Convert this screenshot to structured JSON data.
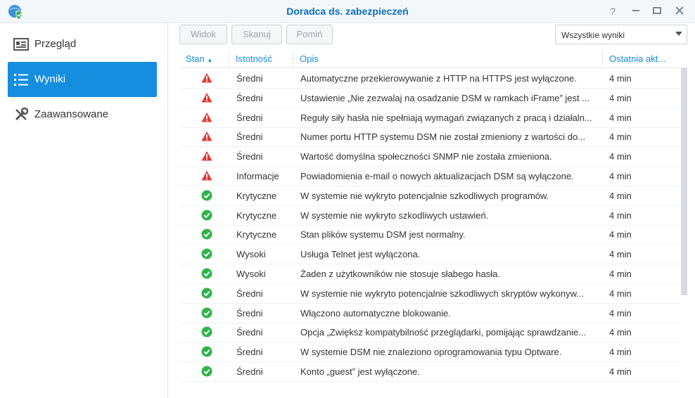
{
  "window": {
    "title": "Doradca ds. zabezpieczeń"
  },
  "sidebar": {
    "items": [
      {
        "label": "Przegląd",
        "icon": "overview-icon"
      },
      {
        "label": "Wyniki",
        "icon": "list-icon"
      },
      {
        "label": "Zaawansowane",
        "icon": "tools-icon"
      }
    ]
  },
  "toolbar": {
    "view_label": "Widok",
    "scan_label": "Skanuj",
    "skip_label": "Pomiń",
    "filter_value": "Wszystkie wyniki"
  },
  "table": {
    "columns": [
      "Stan",
      "Istotność",
      "Opis",
      "Ostatnia akt..."
    ],
    "rows": [
      {
        "status": "warning",
        "severity": "Średni",
        "description": "Automatyczne przekierowywanie z HTTP na HTTPS jest wyłączone.",
        "time": "4 min"
      },
      {
        "status": "warning",
        "severity": "Średni",
        "description": "Ustawienie „Nie zezwalaj na osadzanie DSM w ramkach iFrame” jest ...",
        "time": "4 min"
      },
      {
        "status": "warning",
        "severity": "Średni",
        "description": "Reguły siły hasła nie spełniają wymagań związanych z pracą i działaln...",
        "time": "4 min"
      },
      {
        "status": "warning",
        "severity": "Średni",
        "description": "Numer portu HTTP systemu DSM nie został zmieniony z wartości do...",
        "time": "4 min"
      },
      {
        "status": "warning",
        "severity": "Średni",
        "description": "Wartość domyślna społeczności SNMP nie została zmieniona.",
        "time": "4 min"
      },
      {
        "status": "warning",
        "severity": "Informacje",
        "description": "Powiadomienia e-mail o nowych aktualizacjach DSM są wyłączone.",
        "time": "4 min"
      },
      {
        "status": "ok",
        "severity": "Krytyczne",
        "description": "W systemie nie wykryto potencjalnie szkodliwych programów.",
        "time": "4 min"
      },
      {
        "status": "ok",
        "severity": "Krytyczne",
        "description": "W systemie nie wykryto szkodliwych ustawień.",
        "time": "4 min"
      },
      {
        "status": "ok",
        "severity": "Krytyczne",
        "description": "Stan plików systemu DSM jest normalny.",
        "time": "4 min"
      },
      {
        "status": "ok",
        "severity": "Wysoki",
        "description": "Usługa Telnet jest wyłączona.",
        "time": "4 min"
      },
      {
        "status": "ok",
        "severity": "Wysoki",
        "description": "Żaden z użytkowników nie stosuje słabego hasła.",
        "time": "4 min"
      },
      {
        "status": "ok",
        "severity": "Średni",
        "description": "W systemie nie wykryto potencjalnie szkodliwych skryptów wykonyw...",
        "time": "4 min"
      },
      {
        "status": "ok",
        "severity": "Średni",
        "description": "Włączono automatyczne blokowanie.",
        "time": "4 min"
      },
      {
        "status": "ok",
        "severity": "Średni",
        "description": "Opcja „Zwiększ kompatybilność przeglądarki, pomijając sprawdzanie...",
        "time": "4 min"
      },
      {
        "status": "ok",
        "severity": "Średni",
        "description": "W systemie DSM nie znaleziono oprogramowania typu Optware.",
        "time": "4 min"
      },
      {
        "status": "ok",
        "severity": "Średni",
        "description": "Konto „guest” jest wyłączone.",
        "time": "4 min"
      }
    ]
  },
  "colors": {
    "accent": "#168ee0",
    "warning": "#e53935",
    "ok": "#2fb34a"
  }
}
